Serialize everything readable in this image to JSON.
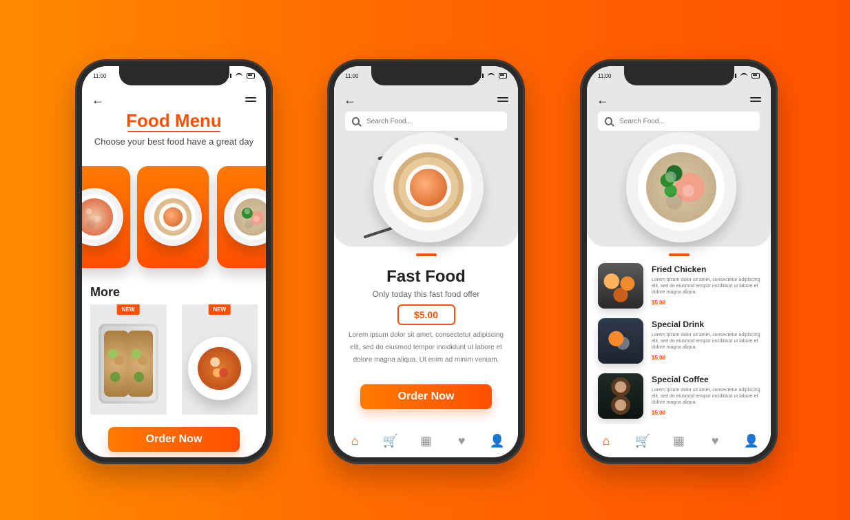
{
  "colors": {
    "accent": "#ff4f00",
    "accent2": "#ff7a00",
    "text": "#222222",
    "muted": "#777777"
  },
  "common": {
    "status_time": "11:00",
    "search_placeholder": "Search Food...",
    "order_button": "Order Now",
    "icons": {
      "back": "←",
      "search": "search-icon",
      "home": "⌂",
      "cart": "🛒",
      "grid": "▦",
      "heart": "♥",
      "user": "👤"
    }
  },
  "phone1": {
    "title": "Food Menu",
    "subtitle": "Choose your best food have a great day",
    "more_title": "More",
    "new_badge": "NEW"
  },
  "phone2": {
    "title": "Fast Food",
    "subtitle": "Only today this fast food offer",
    "price": "$5.00",
    "description": "Lorem ipsum dolor sit amet, consectetur adipiscing elit, sed do eiusmod tempor incididunt ut labore et dolore magna aliqua. Ut enim ad minim veniam."
  },
  "phone3": {
    "items": [
      {
        "title": "Fried Chicken",
        "desc": "Lorem ipsum dolor sit amet, consectetur adipiscing elit, sed do eiusmod tempor incididunt ut labore et dolore magna aliqua.",
        "price": "$5.00"
      },
      {
        "title": "Special Drink",
        "desc": "Lorem ipsum dolor sit amet, consectetur adipiscing elit, sed do eiusmod tempor incididunt ut labore et dolore magna aliqua.",
        "price": "$5.00"
      },
      {
        "title": "Special Coffee",
        "desc": "Lorem ipsum dolor sit amet, consectetur adipiscing elit, sed do eiusmod tempor incididunt ut labore et dolore magna aliqua.",
        "price": "$5.00"
      }
    ]
  }
}
